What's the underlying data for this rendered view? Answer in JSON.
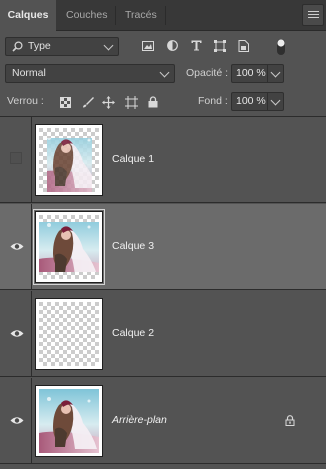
{
  "tabs": [
    {
      "label": "Calques",
      "active": true
    },
    {
      "label": "Couches",
      "active": false
    },
    {
      "label": "Tracés",
      "active": false
    }
  ],
  "filter": {
    "type_label": "Type",
    "icons": [
      "image-filter-icon",
      "adjustment-filter-icon",
      "type-filter-icon",
      "shape-filter-icon",
      "smart-object-filter-icon",
      "filter-toggle-icon"
    ]
  },
  "blend": {
    "mode": "Normal",
    "opacity_label": "Opacité :",
    "opacity_value": "100 %"
  },
  "lock": {
    "label": "Verrou :",
    "icons": [
      "lock-transparent-pixels-icon",
      "lock-image-pixels-icon",
      "lock-position-icon",
      "lock-artboard-icon",
      "lock-all-icon"
    ],
    "fill_label": "Fond :",
    "fill_value": "100 %"
  },
  "layers": [
    {
      "name": "Calque 1",
      "visible": false,
      "selected": false,
      "thumb": "image-transparent",
      "italic": false,
      "locked": false
    },
    {
      "name": "Calque 3",
      "visible": true,
      "selected": true,
      "thumb": "image-transparent",
      "italic": false,
      "locked": false
    },
    {
      "name": "Calque 2",
      "visible": true,
      "selected": false,
      "thumb": "empty",
      "italic": false,
      "locked": false
    },
    {
      "name": "Arrière-plan",
      "visible": true,
      "selected": false,
      "thumb": "image",
      "italic": true,
      "locked": true
    }
  ],
  "colors": {
    "panel": "#535353",
    "tabbar": "#383838",
    "selected_row": "#6b6b6b"
  }
}
